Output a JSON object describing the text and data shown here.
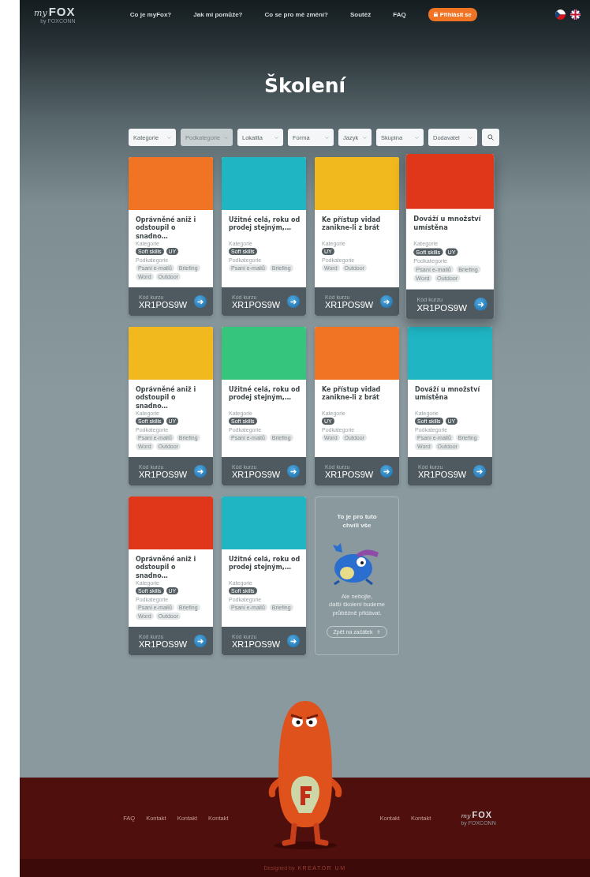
{
  "header": {
    "logo": {
      "script": "my",
      "brand": "FOX",
      "sub": "by FOXCONN"
    },
    "nav": [
      "Co je myFox?",
      "Jak mi pomůže?",
      "Co se pro mě změní?",
      "Soutěž",
      "FAQ"
    ],
    "login": "Přihlásit se"
  },
  "title": "Školení",
  "filters": [
    {
      "label": "Kategorie",
      "disabled": false
    },
    {
      "label": "Podkategorie",
      "disabled": true
    },
    {
      "label": "Lokalita",
      "disabled": false
    },
    {
      "label": "Forma",
      "disabled": false
    },
    {
      "label": "Jazyk",
      "disabled": false
    },
    {
      "label": "Skupina",
      "disabled": false
    },
    {
      "label": "Dodavatel",
      "disabled": false
    }
  ],
  "cards": [
    {
      "kind": "course",
      "color": "#f07423",
      "title": "Oprávněné aniž i odstoupil o snadno…",
      "category_label": "Kategorie",
      "categories": [
        "Soft skills",
        "UY"
      ],
      "subcategory_label": "Podkategorie",
      "subcategories": [
        "Psaní e-mailů",
        "Briefing",
        "Word",
        "Outdoor"
      ],
      "code_label": "Kód kurzu",
      "code": "XR1POS9W",
      "highlighted": false
    },
    {
      "kind": "course",
      "color": "#1fb5c3",
      "title": "Užitné celá, roku od prodej stejným,…",
      "category_label": "Kategorie",
      "categories": [
        "Soft skills"
      ],
      "subcategory_label": "Podkategorie",
      "subcategories": [
        "Psaní e-mailů",
        "Briefing"
      ],
      "code_label": "Kód kurzu",
      "code": "XR1POS9W",
      "highlighted": false
    },
    {
      "kind": "course",
      "color": "#f2b91f",
      "title": "Ke přístup vidad zanikne-li z brát",
      "category_label": "Kategorie",
      "categories": [
        "UY"
      ],
      "subcategory_label": "Podkategorie",
      "subcategories": [
        "Word",
        "Outdoor"
      ],
      "code_label": "Kód kurzu",
      "code": "XR1POS9W",
      "highlighted": false
    },
    {
      "kind": "course",
      "color": "#e0361a",
      "title": "Dováží u množství umístěna",
      "category_label": "Kategorie",
      "categories": [
        "Soft skills",
        "UY"
      ],
      "subcategory_label": "Podkategorie",
      "subcategories": [
        "Psaní e-mailů",
        "Briefing",
        "Word",
        "Outdoor"
      ],
      "code_label": "Kód kurzu",
      "code": "XR1POS9W",
      "highlighted": true
    },
    {
      "kind": "course",
      "color": "#f2b91f",
      "title": "Oprávněné aniž i odstoupil o snadno…",
      "category_label": "Kategorie",
      "categories": [
        "Soft skills",
        "UY"
      ],
      "subcategory_label": "Podkategorie",
      "subcategories": [
        "Psaní e-mailů",
        "Briefing",
        "Word",
        "Outdoor"
      ],
      "code_label": "Kód kurzu",
      "code": "XR1POS9W",
      "highlighted": false
    },
    {
      "kind": "course",
      "color": "#36c57c",
      "title": "Užitné celá, roku od prodej stejným,…",
      "category_label": "Kategorie",
      "categories": [
        "Soft skills"
      ],
      "subcategory_label": "Podkategorie",
      "subcategories": [
        "Psaní e-mailů",
        "Briefing"
      ],
      "code_label": "Kód kurzu",
      "code": "XR1POS9W",
      "highlighted": false
    },
    {
      "kind": "course",
      "color": "#f07423",
      "title": "Ke přístup vidad zanikne-li z brát",
      "category_label": "Kategorie",
      "categories": [
        "UY"
      ],
      "subcategory_label": "Podkategorie",
      "subcategories": [
        "Word",
        "Outdoor"
      ],
      "code_label": "Kód kurzu",
      "code": "XR1POS9W",
      "highlighted": false
    },
    {
      "kind": "course",
      "color": "#1fb5c3",
      "title": "Dováží u množství umístěna",
      "category_label": "Kategorie",
      "categories": [
        "Soft skills",
        "UY"
      ],
      "subcategory_label": "Podkategorie",
      "subcategories": [
        "Psaní e-mailů",
        "Briefing",
        "Word",
        "Outdoor"
      ],
      "code_label": "Kód kurzu",
      "code": "XR1POS9W",
      "highlighted": false
    },
    {
      "kind": "course",
      "color": "#e0361a",
      "title": "Oprávněné aniž i odstoupil o snadno…",
      "category_label": "Kategorie",
      "categories": [
        "Soft skills",
        "UY"
      ],
      "subcategory_label": "Podkategorie",
      "subcategories": [
        "Psaní e-mailů",
        "Briefing",
        "Word",
        "Outdoor"
      ],
      "code_label": "Kód kurzu",
      "code": "XR1POS9W",
      "highlighted": false
    },
    {
      "kind": "course",
      "color": "#1fb5c3",
      "title": "Užitné celá, roku od prodej stejným,…",
      "category_label": "Kategorie",
      "categories": [
        "Soft skills"
      ],
      "subcategory_label": "Podkategorie",
      "subcategories": [
        "Psaní e-mailů",
        "Briefing"
      ],
      "code_label": "Kód kurzu",
      "code": "XR1POS9W",
      "highlighted": false
    },
    {
      "kind": "end",
      "title": "To je pro tuto chvíli vše",
      "lines": [
        "Ale nebojte,",
        "další školení budeme",
        "průběžně přidávat."
      ],
      "button": "Zpět na začátek"
    }
  ],
  "footer": {
    "links_left": [
      "FAQ",
      "Kontakt",
      "Kontakt",
      "Kontakt"
    ],
    "links_right": [
      "Kontakt",
      "Kontakt"
    ],
    "logo": {
      "script": "my",
      "brand": "FOX",
      "sub": "by FOXCONN"
    },
    "credit_prefix": "Designed by",
    "credit_name": "KREATOR UM"
  }
}
